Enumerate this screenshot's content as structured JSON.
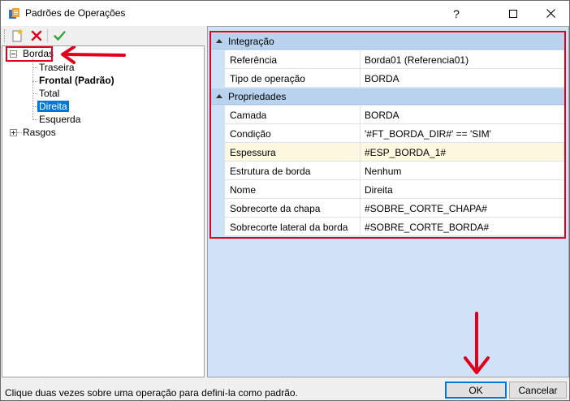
{
  "window": {
    "title": "Padrões de Operações",
    "controls": {
      "help": "?",
      "maximize": "□",
      "close": "✕"
    }
  },
  "toolbar": {
    "icons": [
      "new-item-icon",
      "delete-icon",
      "confirm-check-icon"
    ]
  },
  "tree": {
    "root_bordas": "Bordas",
    "children": [
      "Traseira",
      "Frontal (Padrão)",
      "Total",
      "Direita",
      "Esquerda"
    ],
    "root_rasgos": "Rasgos"
  },
  "properties": {
    "categories": [
      {
        "label": "Integração",
        "rows": [
          {
            "name": "Referência",
            "value": "Borda01 (Referencia01)"
          },
          {
            "name": "Tipo de operação",
            "value": "BORDA"
          }
        ]
      },
      {
        "label": "Propriedades",
        "rows": [
          {
            "name": "Camada",
            "value": "BORDA"
          },
          {
            "name": "Condição",
            "value": "'#FT_BORDA_DIR#' == 'SIM'"
          },
          {
            "name": "Espessura",
            "value": "#ESP_BORDA_1#"
          },
          {
            "name": "Estrutura de borda",
            "value": "Nenhum"
          },
          {
            "name": "Nome",
            "value": "Direita"
          },
          {
            "name": "Sobrecorte da chapa",
            "value": "#SOBRE_CORTE_CHAPA#"
          },
          {
            "name": "Sobrecorte lateral da borda",
            "value": "#SOBRE_CORTE_BORDA#"
          }
        ]
      }
    ]
  },
  "status": {
    "hint": "Clique duas vezes sobre uma operação para defini-la como padrão."
  },
  "buttons": {
    "ok": "OK",
    "cancel": "Cancelar"
  },
  "colors": {
    "accent": "#0078d7",
    "annotation_red": "#e0001b",
    "category_bg": "#b9d3ee",
    "panel_bg": "#cfe2f8",
    "highlight_row": "#fff8e1"
  }
}
